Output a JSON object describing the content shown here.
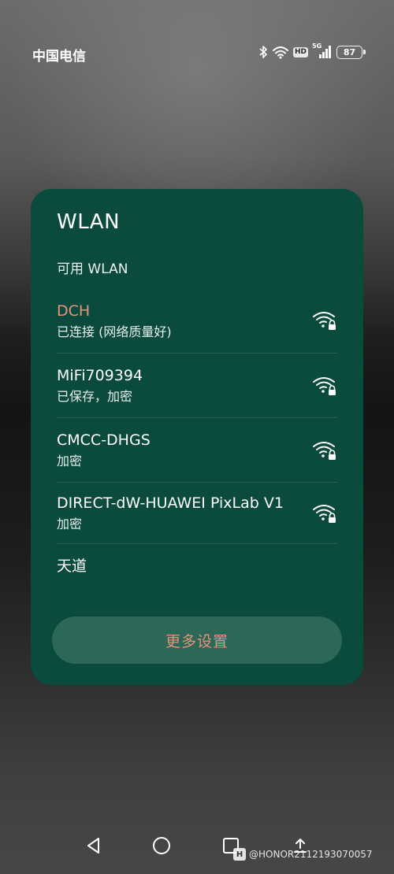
{
  "status_bar": {
    "carrier": "中国电信",
    "hd_label": "HD",
    "network_label": "5G",
    "battery_level": "87",
    "icons": [
      "bluetooth-icon",
      "wifi-icon",
      "hd-icon",
      "cellular-signal-icon",
      "battery-icon"
    ]
  },
  "panel": {
    "title": "WLAN",
    "section_label": "可用 WLAN",
    "networks": [
      {
        "name": "DCH",
        "status": "已连接 (网络质量好)",
        "connected": true,
        "icon": "wifi-lock-icon"
      },
      {
        "name": "MiFi709394",
        "status": "已保存，加密",
        "connected": false,
        "icon": "wifi-lock-icon"
      },
      {
        "name": "CMCC-DHGS",
        "status": "加密",
        "connected": false,
        "icon": "wifi-lock-icon"
      },
      {
        "name": "DIRECT-dW-HUAWEI PixLab V1",
        "status": "加密",
        "connected": false,
        "icon": "wifi-lock-icon"
      },
      {
        "name": "天道",
        "status": "",
        "connected": false,
        "icon": ""
      }
    ],
    "more_settings_label": "更多设置",
    "colors": {
      "panel_bg": "#0b4b3d",
      "accent": "#e3947b",
      "button_bg": "#2c6758"
    }
  },
  "nav_bar": {
    "icons": [
      "back-icon",
      "home-icon",
      "recents-icon",
      "upload-icon"
    ],
    "watermark": "@HONOR2112193070057",
    "watermark_logo": "H"
  }
}
